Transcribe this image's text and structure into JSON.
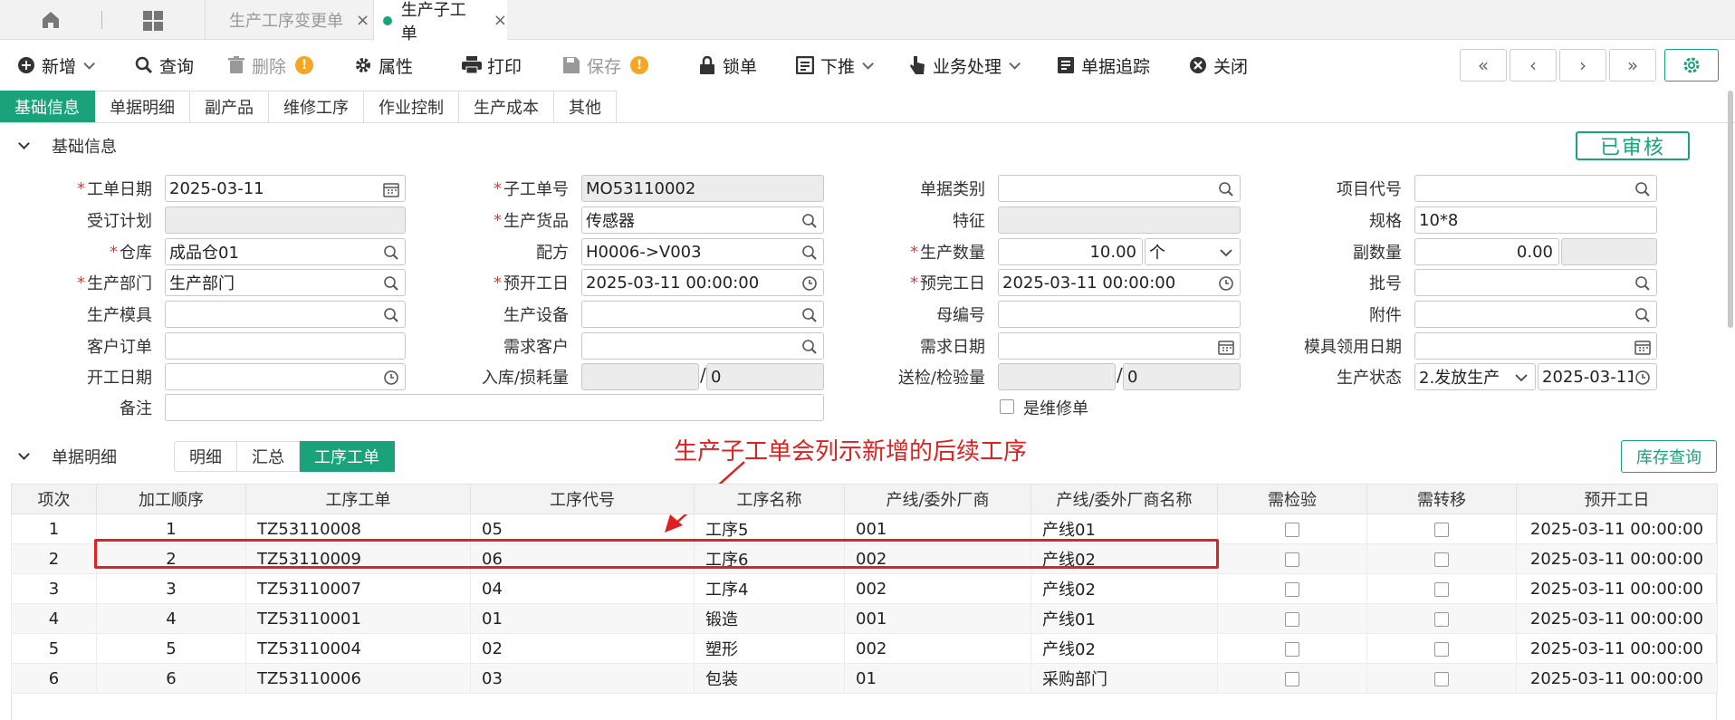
{
  "tabs": [
    {
      "label": "生产工序变更单",
      "close": "×"
    },
    {
      "label": "生产子工单",
      "close": "×"
    }
  ],
  "toolbar": {
    "new": "新增",
    "query": "查询",
    "delete": "删除",
    "props": "属性",
    "print": "打印",
    "save": "保存",
    "lock": "锁单",
    "pushdown": "下推",
    "business": "业务处理",
    "trace": "单据追踪",
    "close": "关闭",
    "warn": "!"
  },
  "nav": {
    "first": "«",
    "prev": "‹",
    "next": "›",
    "last": "»"
  },
  "subtabs": [
    "基础信息",
    "单据明细",
    "副产品",
    "维修工序",
    "作业控制",
    "生产成本",
    "其他"
  ],
  "basic": {
    "title": "基础信息",
    "status": "已审核"
  },
  "form": {
    "work_date": {
      "label": "工单日期",
      "value": "2025-03-11"
    },
    "order_plan": {
      "label": "受订计划",
      "value": ""
    },
    "warehouse": {
      "label": "仓库",
      "value": "成品仓01"
    },
    "dept": {
      "label": "生产部门",
      "value": "生产部门"
    },
    "mold": {
      "label": "生产模具",
      "value": ""
    },
    "cust_order": {
      "label": "客户订单",
      "value": ""
    },
    "start_date": {
      "label": "开工日期",
      "value": ""
    },
    "remark": {
      "label": "备注",
      "value": ""
    },
    "sub_no": {
      "label": "子工单号",
      "value": "MO53110002"
    },
    "goods": {
      "label": "生产货品",
      "value": "传感器"
    },
    "recipe": {
      "label": "配方",
      "value": "H0006->V003"
    },
    "plan_start": {
      "label": "预开工日",
      "value": "2025-03-11 00:00:00"
    },
    "equipment": {
      "label": "生产设备",
      "value": ""
    },
    "demand_cust": {
      "label": "需求客户",
      "value": ""
    },
    "in_loss": {
      "label": "入库/损耗量",
      "value1": "",
      "value2": "0"
    },
    "doc_type": {
      "label": "单据类别",
      "value": ""
    },
    "feature": {
      "label": "特征",
      "value": ""
    },
    "qty": {
      "label": "生产数量",
      "value": "10.00",
      "unit": "个"
    },
    "plan_end": {
      "label": "预完工日",
      "value": "2025-03-11 00:00:00"
    },
    "parent_no": {
      "label": "母编号",
      "value": ""
    },
    "demand_date": {
      "label": "需求日期",
      "value": ""
    },
    "inspect": {
      "label": "送检/检验量",
      "value1": "",
      "value2": "0"
    },
    "is_repair": {
      "label": "是维修单"
    },
    "project": {
      "label": "项目代号",
      "value": ""
    },
    "spec": {
      "label": "规格",
      "value": "10*8"
    },
    "sub_qty": {
      "label": "副数量",
      "value": "0.00",
      "value2": ""
    },
    "batch": {
      "label": "批号",
      "value": ""
    },
    "attach": {
      "label": "附件",
      "value": ""
    },
    "mold_date": {
      "label": "模具领用日期",
      "value": ""
    },
    "prod_status": {
      "label": "生产状态",
      "value": "2.发放生产",
      "date": "2025-03-11"
    }
  },
  "detail": {
    "title": "单据明细",
    "tabs": [
      "明细",
      "汇总",
      "工序工单"
    ],
    "stock_query": "库存查询",
    "annotation": "生产子工单会列示新增的后续工序"
  },
  "table": {
    "columns": [
      "项次",
      "加工顺序",
      "工序工单",
      "工序代号",
      "工序名称",
      "产线/委外厂商",
      "产线/委外厂商名称",
      "需检验",
      "需转移",
      "预开工日"
    ],
    "rows": [
      {
        "seq": "1",
        "order": "1",
        "wo": "TZ53110008",
        "code": "05",
        "name": "工序5",
        "line": "001",
        "line_name": "产线01",
        "date": "2025-03-11 00:00:00"
      },
      {
        "seq": "2",
        "order": "2",
        "wo": "TZ53110009",
        "code": "06",
        "name": "工序6",
        "line": "002",
        "line_name": "产线02",
        "date": "2025-03-11 00:00:00"
      },
      {
        "seq": "3",
        "order": "3",
        "wo": "TZ53110007",
        "code": "04",
        "name": "工序4",
        "line": "002",
        "line_name": "产线02",
        "date": "2025-03-11 00:00:00"
      },
      {
        "seq": "4",
        "order": "4",
        "wo": "TZ53110001",
        "code": "01",
        "name": "锻造",
        "line": "001",
        "line_name": "产线01",
        "date": "2025-03-11 00:00:00"
      },
      {
        "seq": "5",
        "order": "5",
        "wo": "TZ53110004",
        "code": "02",
        "name": "塑形",
        "line": "002",
        "line_name": "产线02",
        "date": "2025-03-11 00:00:00"
      },
      {
        "seq": "6",
        "order": "6",
        "wo": "TZ53110006",
        "code": "03",
        "name": "包装",
        "line": "01",
        "line_name": "采购部门",
        "date": "2025-03-11 00:00:00"
      }
    ]
  },
  "colors": {
    "accent": "#1aa37a",
    "required": "#e53935",
    "annotation": "#e02020",
    "warn": "#f5a623"
  }
}
